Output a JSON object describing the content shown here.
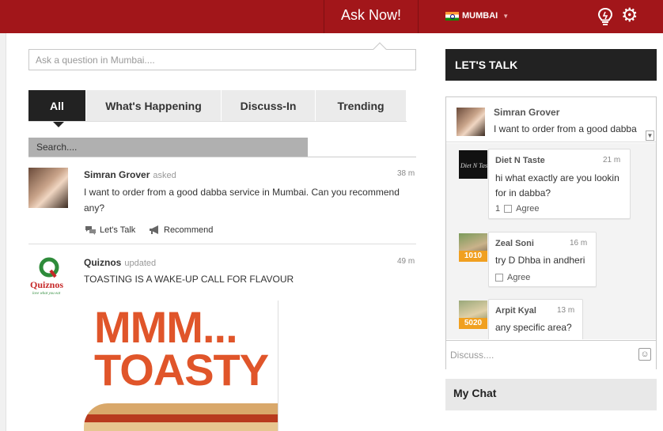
{
  "header": {
    "ask_now_label": "Ask Now!",
    "city": "MUMBAI",
    "icons": [
      "lightbulb-icon",
      "gear-icon"
    ],
    "accent_color": "#a2161a"
  },
  "ask": {
    "placeholder": "Ask a question in Mumbai...."
  },
  "tabs": [
    {
      "label": "All",
      "active": true
    },
    {
      "label": "What's Happening",
      "active": false
    },
    {
      "label": "Discuss-In",
      "active": false
    },
    {
      "label": "Trending",
      "active": false
    }
  ],
  "search": {
    "placeholder": "Search...."
  },
  "feed": [
    {
      "author": "Simran Grover",
      "verb": "asked",
      "time": "38 m",
      "text_line1": "I want to order from a good dabba service in Mumbai. Can you recommend",
      "text_line2": "any?",
      "actions": [
        "Let's Talk",
        "Recommend"
      ]
    },
    {
      "author": "Quiznos",
      "verb": "updated",
      "time": "49 m",
      "text": "TOASTING IS A WAKE-UP CALL FOR FLAVOUR",
      "logo_text": "Quiznos",
      "logo_tagline": "love what you eat",
      "ad_line1": "MMM...",
      "ad_line2": "TOASTY"
    }
  ],
  "lets_talk": {
    "title": "LET'S TALK",
    "topic_author": "Simran Grover",
    "topic_text": "I want to order from a good dabba",
    "comments": [
      {
        "author": "Diet N Taste",
        "time": "21 m",
        "line1": "hi what exactly are you lookin",
        "line2": "for in dabba?",
        "agree_count": "1",
        "agree_label": "Agree",
        "avatar_text": "Diet N Taste"
      },
      {
        "author": "Zeal Soni",
        "time": "16 m",
        "line1": "try D Dhba in andheri",
        "agree_label": "Agree",
        "karma": "1010"
      },
      {
        "author": "Arpit Kyal",
        "time": "13 m",
        "line1": "any specific area?",
        "karma": "5020"
      }
    ],
    "discuss_placeholder": "Discuss...."
  },
  "my_chat": {
    "title": "My Chat"
  }
}
